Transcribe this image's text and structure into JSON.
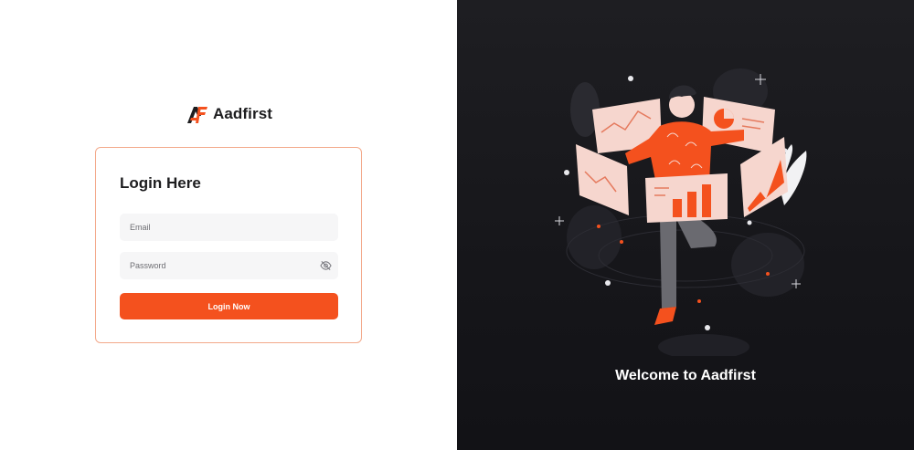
{
  "brand": {
    "name": "Aadfirst",
    "logo_text": "AF"
  },
  "login": {
    "title": "Login Here",
    "email_placeholder": "Email",
    "email_value": "",
    "password_placeholder": "Password",
    "password_value": "",
    "submit_label": "Login Now"
  },
  "hero": {
    "welcome": "Welcome to Aadfirst"
  },
  "icons": {
    "password_toggle": "eye-off-icon",
    "logo": "aadfirst-logo-icon"
  },
  "colors": {
    "accent": "#f4511e",
    "card_border": "#f3a98a",
    "dark_bg": "#1a1a1e",
    "input_bg": "#f6f6f7"
  }
}
